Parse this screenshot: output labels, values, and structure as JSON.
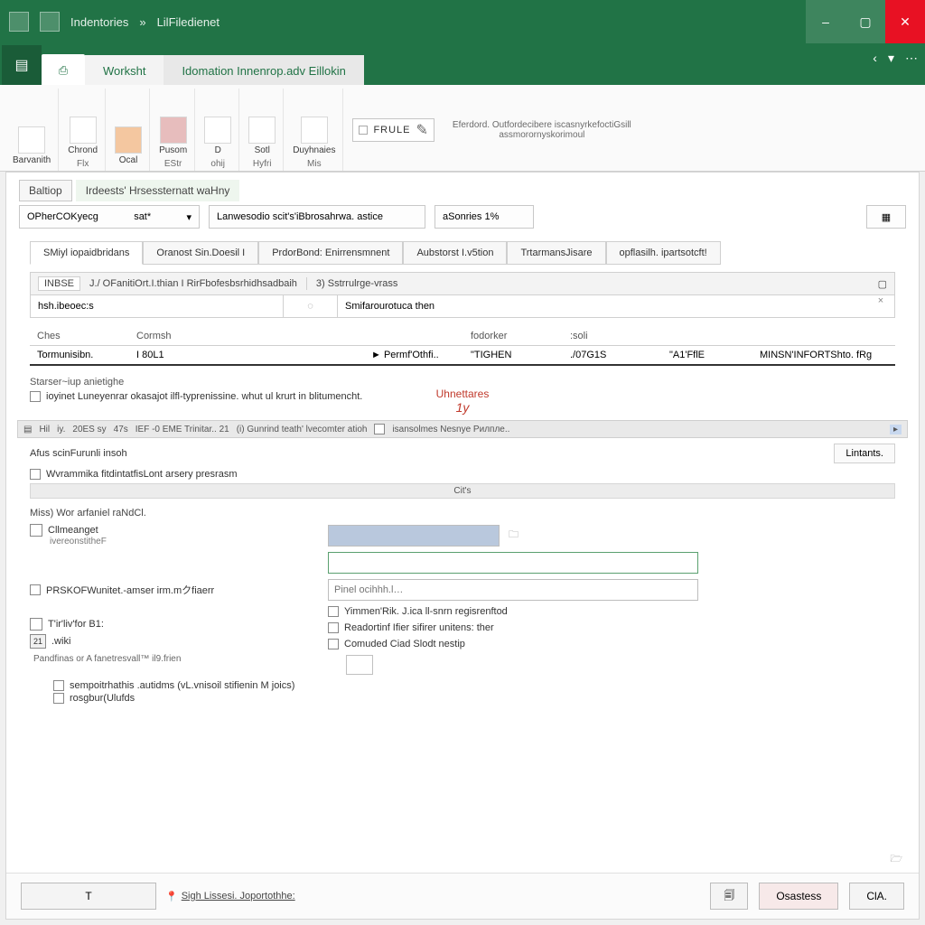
{
  "title": {
    "app": "Indentories",
    "doc": "LilFiledienet"
  },
  "window_controls": {
    "min": "–",
    "max": "▢",
    "close": "✕"
  },
  "tabs": {
    "file_glyph": "▤",
    "main": "Worksht",
    "secondary": "Idomation Innenrop.adv Eillokin"
  },
  "tabbar_right": [
    "‹",
    "▾",
    "⋯"
  ],
  "ribbon": {
    "groups": [
      {
        "items": [
          "Barvanith"
        ],
        "label": ""
      },
      {
        "items": [
          "Chrond"
        ],
        "label": "Flx"
      },
      {
        "items": [
          "Ocal"
        ],
        "label": ""
      },
      {
        "items": [
          "Pusom"
        ],
        "label": "EStr"
      },
      {
        "items": [
          "D"
        ],
        "label": "ohij"
      },
      {
        "items": [
          "Sotl"
        ],
        "label": "Hyfri"
      },
      {
        "items": [
          "Duyhnaies"
        ],
        "label": "Mis"
      }
    ],
    "rule_label": "FRULE",
    "rule_glyph": "✎",
    "note": "Eferdord. Outfordecibere iscasnyrkefoctiGsill",
    "note2": "assmorornyskorimoul"
  },
  "ws": {
    "tabs": [
      "Baltiop",
      "Irdeests' Hrsessternatt waHny"
    ],
    "field1_label": "OPherCOKyecg",
    "field1_val": "sat*",
    "field2": "Lanwesodio scit's'iBbrosahrwa. astice",
    "field3": "aSonries 1%",
    "corner_glyph": "▦"
  },
  "subtabs": [
    "SMiyl iopaidbridans",
    "Oranost Sin.Doesil I",
    "PrdorBond: Enirrensmnent",
    "Aubstorst I.v5tion",
    "TrtarmansJisare",
    "opflasilh. ipartsotcft!"
  ],
  "bar1": {
    "a": "INBSE",
    "b": "J./ OFanitiOrt.I.thian I RirFbofesbsrhidhsadbaih",
    "c": "3) Sstrrulrge-vrass"
  },
  "kv": {
    "left": "hsh.ibeoec:s",
    "mid": "◌",
    "right": "Smifarourotuca then"
  },
  "table": {
    "headers": [
      "Ches",
      "Cormsh",
      "",
      "",
      "fodorker",
      ":soli",
      "",
      ""
    ],
    "row": [
      "Tormunisibn.",
      "I 80L1",
      "",
      "► Permf'Othfi..",
      "\"TIGHEN",
      "./07G1S",
      "\"A1'FflE",
      "MINSN'INFORTShto. fRg"
    ]
  },
  "sec1": "Starser~iup anietighe",
  "chk1": "ioyinet Luneyenrar okasajot ilfl-typrenissine. whut ul krurt in blitumencht.",
  "warn": "Uhnettares",
  "warn2": "1y",
  "strip": [
    "Hil",
    "iy.",
    "20ES  sy",
    "47s",
    "IEF -0  EME  Trinitar.. 21",
    "(i) Gunrind teath' lvecomter atioh",
    "isansolmes Nesnye Рилпле.."
  ],
  "sec2": "Afus scinFurunli insoh",
  "details_btn": "Lintants.",
  "chk2": "Wvrammika fitdintatfisLont arsery presrasm",
  "mid_label": "Cit's",
  "form": {
    "title": "Miss) Wor arfaniel raNdCl.",
    "r1": "Cllmeanget",
    "r1b": "ivereonstitheF",
    "r2_label": "PRSKOFWunitet.-amser irm.mクfiaerr",
    "r2_ph": "Pinel ocihhh.l…",
    "r3": "T'ir'liv'for B1:",
    "r3b": ".wiki",
    "r4": "Pandfinas or A fanetresvall™ il9.frien",
    "rr1": "Yimmen'Rik. J.ica ll-snrn regisrenftod",
    "rr2": "Readortinf Ifier sifirer unitens: ther",
    "rr3": "Comuded Ciad Slodt nestip",
    "c3": "sempoitrhathis .autidms  (vL.vnisoil stifienin  M joics)",
    "c4": "rosgbur(Ulufds"
  },
  "footer": {
    "left_a": "T",
    "left_b": "Sigh Lissesi. Joportothhe:",
    "confirm": "Osastess",
    "close": "ClA."
  }
}
